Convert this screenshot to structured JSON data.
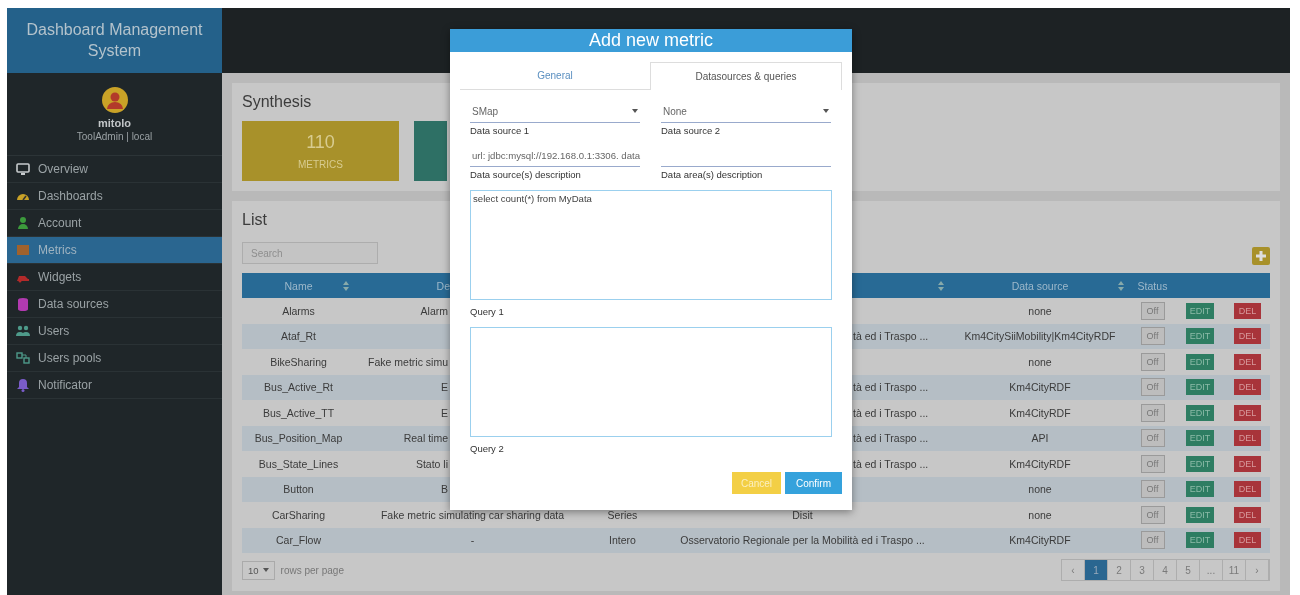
{
  "sidebar": {
    "title": "Dashboard Management System",
    "user": {
      "name": "mitolo",
      "role": "ToolAdmin | local"
    },
    "items": [
      {
        "label": "Overview",
        "selected": false
      },
      {
        "label": "Dashboards",
        "selected": false
      },
      {
        "label": "Account",
        "selected": false
      },
      {
        "label": "Metrics",
        "selected": true
      },
      {
        "label": "Widgets",
        "selected": false
      },
      {
        "label": "Data sources",
        "selected": false
      },
      {
        "label": "Users",
        "selected": false
      },
      {
        "label": "Users pools",
        "selected": false
      },
      {
        "label": "Notificator",
        "selected": false
      }
    ]
  },
  "synthesis": {
    "title": "Synthesis",
    "cards": [
      {
        "value": "110",
        "label": "METRICS"
      }
    ]
  },
  "list": {
    "title": "List",
    "search": {
      "placeholder": "Search"
    },
    "columns": [
      {
        "label": "Name",
        "sortable": true
      },
      {
        "label": "De",
        "sortable": false
      },
      {
        "sortable": true
      },
      {
        "label": "Data source",
        "sortable": true
      },
      {
        "label": "Status",
        "sortable": false
      }
    ],
    "rows": [
      {
        "name": "Alarms",
        "description": "Alarm",
        "data_source": "none",
        "status": {
          "label": "Off",
          "on": false
        },
        "edit": "EDIT",
        "delete": "DEL"
      },
      {
        "name": "Ataf_Rt",
        "organization": "tà ed i Traspo ...",
        "data_source": "Km4CitySiiMobility|Km4CityRDF",
        "status": {
          "label": "Off",
          "on": false
        },
        "edit": "EDIT",
        "delete": "DEL"
      },
      {
        "name": "BikeSharing",
        "description": "Fake metric simu",
        "data_source": "none",
        "status": {
          "label": "Off",
          "on": false
        },
        "edit": "EDIT",
        "delete": "DEL"
      },
      {
        "name": "Bus_Active_Rt",
        "description": "E",
        "organization": "tà ed i Traspo ...",
        "data_source": "Km4CityRDF",
        "status": {
          "label": "Off",
          "on": false
        },
        "edit": "EDIT",
        "delete": "DEL"
      },
      {
        "name": "Bus_Active_TT",
        "description": "E",
        "organization": "tà ed i Traspo ...",
        "data_source": "Km4CityRDF",
        "status": {
          "label": "Off",
          "on": false
        },
        "edit": "EDIT",
        "delete": "DEL"
      },
      {
        "name": "Bus_Position_Map",
        "description": "Real time",
        "organization": "tà ed i Traspo ...",
        "data_source": "API",
        "status": {
          "label": "Off",
          "on": false
        },
        "edit": "EDIT",
        "delete": "DEL"
      },
      {
        "name": "Bus_State_Lines",
        "description": "Stato li",
        "organization": "tà ed i Traspo ...",
        "data_source": "Km4CityRDF",
        "status": {
          "label": "Off",
          "on": false
        },
        "edit": "EDIT",
        "delete": "DEL"
      },
      {
        "name": "Button",
        "description": "B",
        "data_source": "none",
        "status": {
          "label": "Off",
          "on": false
        },
        "edit": "EDIT",
        "delete": "DEL"
      },
      {
        "name": "CarSharing",
        "description": "Fake metric simulating car sharing data",
        "type": "Series",
        "organization": "Disit",
        "data_source": "none",
        "status": {
          "label": "Off",
          "on": false
        },
        "edit": "EDIT",
        "delete": "DEL"
      },
      {
        "name": "Car_Flow",
        "description": "-",
        "type": "Intero",
        "organization": "Osservatorio Regionale per la Mobilità ed i Traspo ...",
        "data_source": "Km4CityRDF",
        "status": {
          "label": "Off",
          "on": false
        },
        "edit": "EDIT",
        "delete": "DEL"
      }
    ],
    "rows_per_page": {
      "value": "10",
      "label": "rows per page"
    },
    "pagination": [
      {
        "label": "‹",
        "selected": false
      },
      {
        "label": "1",
        "selected": true
      },
      {
        "label": "2",
        "selected": false
      },
      {
        "label": "3",
        "selected": false
      },
      {
        "label": "4",
        "selected": false
      },
      {
        "label": "5",
        "selected": false
      },
      {
        "label": "...",
        "selected": false
      },
      {
        "label": "11",
        "selected": false
      },
      {
        "label": "›",
        "selected": false
      }
    ]
  },
  "modal": {
    "title": "Add new metric",
    "tabs": [
      {
        "label": "General",
        "selected": false
      },
      {
        "label": "Datasources & queries",
        "selected": true
      }
    ],
    "selects": [
      {
        "value": "SMap",
        "label": "Data source 1"
      },
      {
        "value": "None",
        "label": "Data source 2"
      }
    ],
    "inputs": [
      {
        "value": "url: jdbc:mysql://192.168.0.1:3306. data",
        "label": "Data source(s) description"
      },
      {
        "label": "Data area(s) description"
      }
    ],
    "queries": [
      {
        "value": "select count(*) from MyData",
        "label": "Query 1"
      },
      {
        "label": "Query 2"
      }
    ],
    "buttons": [
      {
        "label": "Cancel",
        "kind": "cancel"
      },
      {
        "label": "Confirm",
        "kind": "confirm"
      }
    ]
  }
}
